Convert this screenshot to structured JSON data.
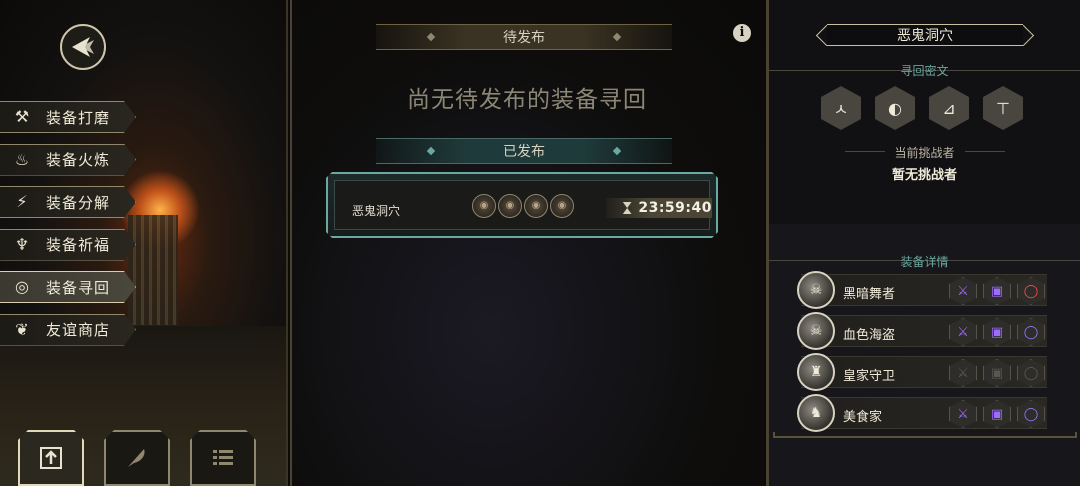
{
  "left_menu": {
    "items": [
      {
        "label": "装备打磨",
        "icon": "hammer-icon",
        "glyph": "⚒",
        "active": false
      },
      {
        "label": "装备火炼",
        "icon": "flame-icon",
        "glyph": "♨",
        "active": false
      },
      {
        "label": "装备分解",
        "icon": "disassemble-icon",
        "glyph": "⚡",
        "active": false
      },
      {
        "label": "装备祈福",
        "icon": "bless-icon",
        "glyph": "♆",
        "active": false
      },
      {
        "label": "装备寻回",
        "icon": "target-icon",
        "glyph": "◎",
        "active": true
      },
      {
        "label": "友谊商店",
        "icon": "fox-icon",
        "glyph": "❦",
        "active": false
      }
    ]
  },
  "middle": {
    "pending_header": "待发布",
    "empty_message": "尚无待发布的装备寻回",
    "published_header": "已发布",
    "quest": {
      "name": "恶鬼洞穴",
      "timer": "23:59:40",
      "heroes": [
        "beast-icon",
        "lizard-icon",
        "skull-icon",
        "boar-icon"
      ]
    }
  },
  "right": {
    "title": "恶鬼洞穴",
    "runes_label": "寻回密文",
    "runes": [
      "ㅅ",
      "◐",
      "⊿",
      "⊤"
    ],
    "challenger_label": "当前挑战者",
    "challenger_value": "暂无挑战者",
    "details_label": "装备详情",
    "heroes": [
      {
        "name": "黑暗舞者",
        "slots": [
          "weapon-on",
          "armor-on",
          "ring-red"
        ]
      },
      {
        "name": "血色海盗",
        "slots": [
          "weapon-on",
          "armor-on",
          "ring-purple"
        ]
      },
      {
        "name": "皇家守卫",
        "slots": [
          "empty",
          "empty",
          "empty"
        ]
      },
      {
        "name": "美食家",
        "slots": [
          "weapon-on",
          "armor-on",
          "ring-purple"
        ]
      }
    ]
  }
}
